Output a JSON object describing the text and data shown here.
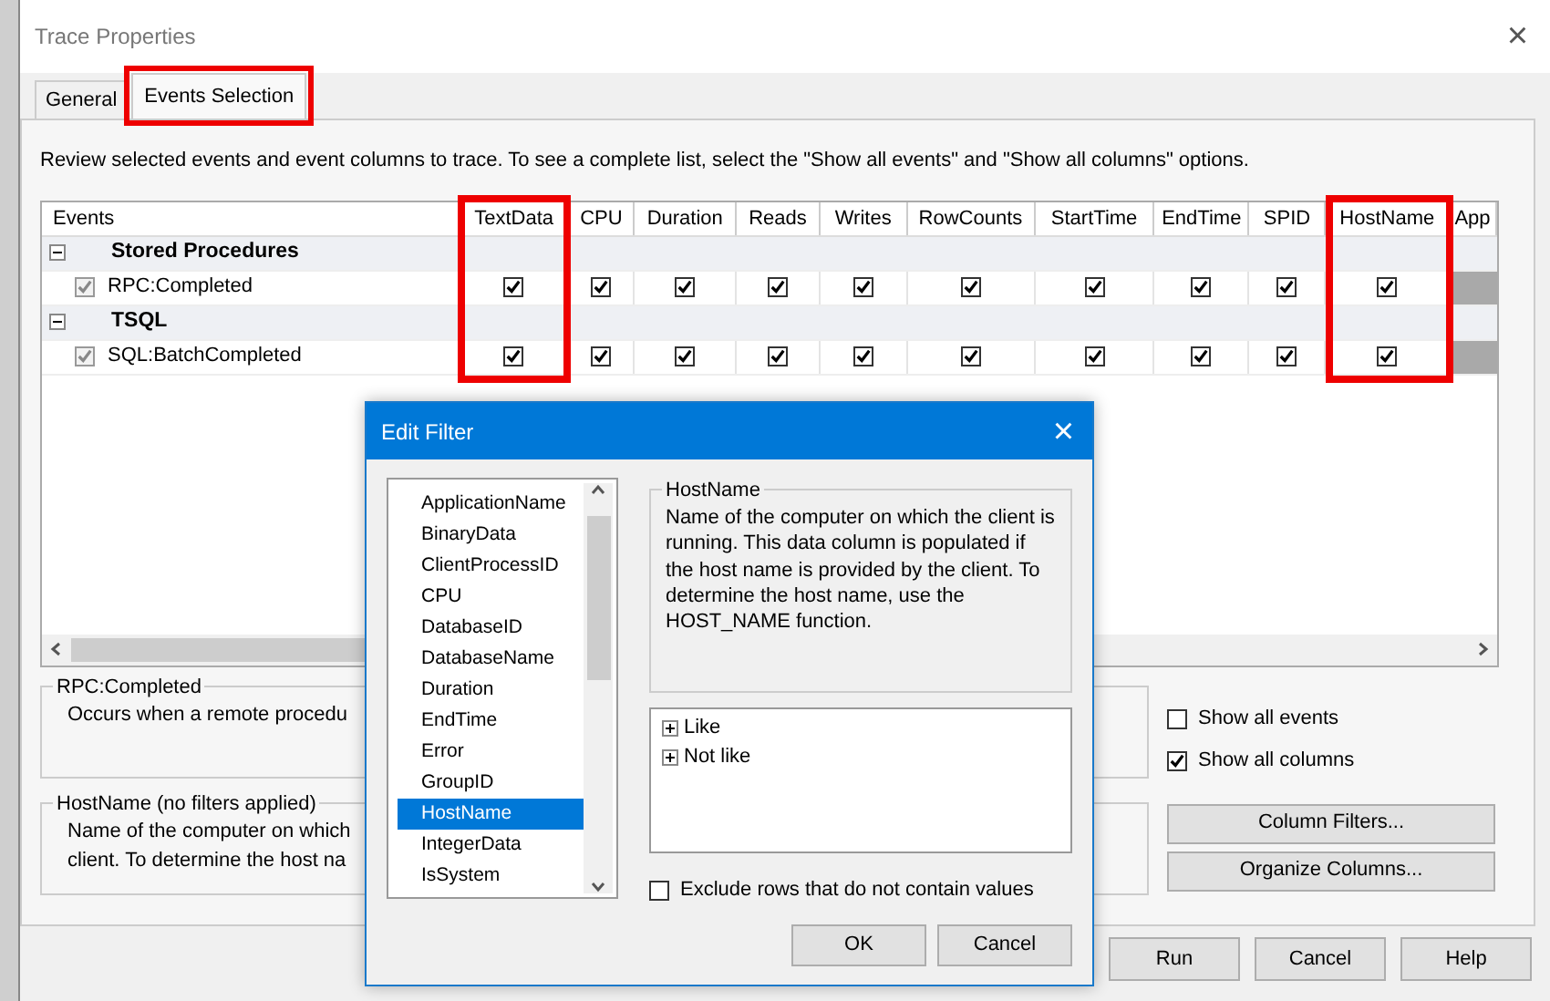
{
  "window": {
    "title": "Trace Properties",
    "close": "×"
  },
  "tabs": [
    {
      "label": "General",
      "selected": false,
      "highlighted": false
    },
    {
      "label": "Events Selection",
      "selected": true,
      "highlighted": true
    }
  ],
  "instructions": "Review selected events and event columns to trace. To see a complete list, select the \"Show all events\" and \"Show all columns\" options.",
  "grid": {
    "columns": [
      {
        "label": "Events",
        "highlighted": false
      },
      {
        "label": "TextData",
        "highlighted": true
      },
      {
        "label": "CPU",
        "highlighted": false
      },
      {
        "label": "Duration",
        "highlighted": false
      },
      {
        "label": "Reads",
        "highlighted": false
      },
      {
        "label": "Writes",
        "highlighted": false
      },
      {
        "label": "RowCounts",
        "highlighted": false
      },
      {
        "label": "StartTime",
        "highlighted": false
      },
      {
        "label": "EndTime",
        "highlighted": false
      },
      {
        "label": "SPID",
        "highlighted": false
      },
      {
        "label": "HostName",
        "highlighted": true
      },
      {
        "label": "App",
        "highlighted": false
      }
    ],
    "rows": [
      {
        "kind": "category",
        "label": "Stored Procedures",
        "expanded": true
      },
      {
        "kind": "event",
        "label": "RPC:Completed",
        "checked": true,
        "cells": [
          true,
          true,
          true,
          true,
          true,
          true,
          true,
          true,
          true,
          true
        ]
      },
      {
        "kind": "category",
        "label": "TSQL",
        "expanded": true
      },
      {
        "kind": "event",
        "label": "SQL:BatchCompleted",
        "checked": true,
        "cells": [
          true,
          true,
          true,
          true,
          true,
          true,
          true,
          true,
          true,
          true
        ]
      }
    ]
  },
  "event_info": {
    "title": "RPC:Completed",
    "lines": [
      "Occurs when a remote procedu"
    ]
  },
  "column_info": {
    "title": "HostName (no filters applied)",
    "lines": [
      "Name of the computer on which",
      "client. To determine the host na"
    ]
  },
  "options": [
    {
      "label": "Show all events",
      "checked": false
    },
    {
      "label": "Show all columns",
      "checked": true
    }
  ],
  "side_buttons": [
    "Column Filters...",
    "Organize Columns..."
  ],
  "buttons": [
    "Run",
    "Cancel",
    "Help"
  ],
  "edit_filter": {
    "title": "Edit Filter",
    "close": "×",
    "columns": [
      {
        "label": "ApplicationName",
        "selected": false
      },
      {
        "label": "BinaryData",
        "selected": false
      },
      {
        "label": "ClientProcessID",
        "selected": false
      },
      {
        "label": "CPU",
        "selected": false
      },
      {
        "label": "DatabaseID",
        "selected": false
      },
      {
        "label": "DatabaseName",
        "selected": false
      },
      {
        "label": "Duration",
        "selected": false
      },
      {
        "label": "EndTime",
        "selected": false
      },
      {
        "label": "Error",
        "selected": false
      },
      {
        "label": "GroupID",
        "selected": false
      },
      {
        "label": "HostName",
        "selected": true
      },
      {
        "label": "IntegerData",
        "selected": false
      },
      {
        "label": "IsSystem",
        "selected": false
      }
    ],
    "detail": {
      "title": "HostName",
      "text": "Name of the computer on which the client is running. This data column is populated if the host name is provided by the client. To determine the host name, use the HOST_NAME function."
    },
    "operators": [
      "Like",
      "Not like"
    ],
    "exclude": {
      "label": "Exclude rows that do not contain values",
      "checked": false
    },
    "buttons": [
      "OK",
      "Cancel"
    ]
  }
}
